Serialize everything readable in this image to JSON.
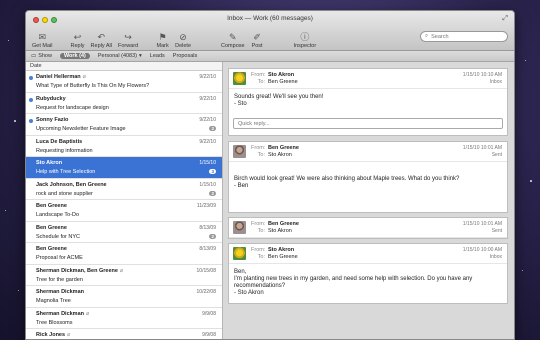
{
  "window": {
    "title": "Inbox — Work (60 messages)"
  },
  "toolbar": {
    "buttons": [
      {
        "label": "Get Mail",
        "icon": "envelope-icon"
      },
      {
        "label": "Reply",
        "icon": "reply-icon"
      },
      {
        "label": "Reply All",
        "icon": "reply-all-icon"
      },
      {
        "label": "Forward",
        "icon": "forward-icon"
      },
      {
        "label": "Mark",
        "icon": "mark-icon"
      },
      {
        "label": "Delete",
        "icon": "delete-icon"
      },
      {
        "label": "Compose",
        "icon": "compose-icon"
      },
      {
        "label": "Post",
        "icon": "post-icon"
      },
      {
        "label": "Inspector",
        "icon": "info-icon"
      }
    ],
    "search_placeholder": "Search"
  },
  "filterbar": {
    "show_label": "Show",
    "work_label": "Work (4)",
    "personal_label": "Personal (4083)",
    "leads_label": "Leads",
    "proposals_label": "Proposals"
  },
  "list": {
    "header": "Date",
    "rows": [
      {
        "sender": "Daniel Hellerman",
        "subject": "What Type of Butterfly Is This On My Flowers?",
        "date": "9/22/10",
        "badge": "",
        "unread": true,
        "attach": true
      },
      {
        "sender": "Rubyducky",
        "subject": "Request for landscape design",
        "date": "9/22/10",
        "badge": "",
        "unread": true,
        "attach": false
      },
      {
        "sender": "Sonny Fazio",
        "subject": "Upcoming Newsletter Feature Image",
        "date": "9/22/10",
        "badge": "2",
        "unread": true,
        "attach": false
      },
      {
        "sender": "Luca De Baptistis",
        "subject": "Requesting information",
        "date": "9/22/10",
        "badge": "",
        "unread": false,
        "attach": false
      },
      {
        "sender": "Sto Akron",
        "subject": "Help with Tree Selection",
        "date": "1/15/10",
        "badge": "3",
        "unread": false,
        "attach": false,
        "selected": true
      },
      {
        "sender": "Jack Johnson, Ben Greene",
        "subject": "rock and stone supplier",
        "date": "1/15/10",
        "badge": "2",
        "unread": false,
        "attach": false
      },
      {
        "sender": "Ben Greene",
        "subject": "Landscape To-Do",
        "date": "11/23/09",
        "badge": "",
        "unread": false,
        "attach": false
      },
      {
        "sender": "Ben Greene",
        "subject": "Schedule for NYC",
        "date": "8/13/09",
        "badge": "2",
        "unread": false,
        "attach": false
      },
      {
        "sender": "Ben Greene",
        "subject": "Proposal for ACME",
        "date": "8/13/09",
        "badge": "",
        "unread": false,
        "attach": false
      },
      {
        "sender": "Sherman Dickman, Ben Greene",
        "subject": "Tree for the garden",
        "date": "10/15/08",
        "badge": "",
        "unread": false,
        "attach": true
      },
      {
        "sender": "Sherman Dickman",
        "subject": "Magnolia Tree",
        "date": "10/22/08",
        "badge": "",
        "unread": false,
        "attach": false
      },
      {
        "sender": "Sherman Dickman",
        "subject": "Tree Blossoms",
        "date": "9/9/08",
        "badge": "",
        "unread": false,
        "attach": true
      },
      {
        "sender": "Rick Jones",
        "subject": "Travel Pictures",
        "date": "9/9/08",
        "badge": "",
        "unread": false,
        "attach": true
      }
    ]
  },
  "conversation": {
    "from_label": "From:",
    "to_label": "To:",
    "quick_reply_placeholder": "Quick reply...",
    "messages": [
      {
        "from": "Sto Akron",
        "to": "Ben Greene",
        "date": "1/15/10 10:10 AM",
        "folder": "Inbox",
        "avatar": "flower",
        "body": [
          "Sounds great!  We'll see you then!",
          "- Sto"
        ],
        "quick_reply": true
      },
      {
        "from": "Ben Greene",
        "to": "Sto Akron",
        "date": "1/15/10 10:01 AM",
        "folder": "Sent",
        "avatar": "person",
        "body": [
          "Birch would look great! We were also thinking about Maple trees.  What do you think?",
          "- Ben"
        ],
        "quick_reply": false
      },
      {
        "from": "Ben Greene",
        "to": "Sto Akron",
        "date": "1/15/10 10:01 AM",
        "folder": "Sent",
        "avatar": "person",
        "body": [],
        "quick_reply": false
      },
      {
        "from": "Sto Akron",
        "to": "Ben Greene",
        "date": "1/15/10 10:00 AM",
        "folder": "Inbox",
        "avatar": "flower",
        "body": [
          "Ben,",
          "I'm planting new trees in my garden, and need some help with selection.  Do you have any recommendations?",
          "- Sto Akron"
        ],
        "quick_reply": false
      }
    ]
  }
}
